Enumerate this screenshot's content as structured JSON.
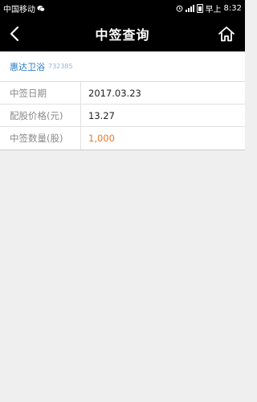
{
  "status_bar": {
    "carrier": "中国移动",
    "time_prefix": "早上",
    "time": "8:32"
  },
  "nav": {
    "title": "中签查询"
  },
  "stock": {
    "name": "惠达卫浴",
    "code": "732385"
  },
  "rows": [
    {
      "label": "中签日期",
      "value": "2017.03.23"
    },
    {
      "label": "配股价格(元)",
      "value": "13.27"
    },
    {
      "label": "中签数量(股)",
      "value": "1,000"
    }
  ],
  "colors": {
    "accent": "#2a7cc7",
    "highlight": "#e8792b",
    "header_bg": "#000000"
  },
  "icons": {
    "back": "chevron-left-icon",
    "home": "home-icon"
  }
}
